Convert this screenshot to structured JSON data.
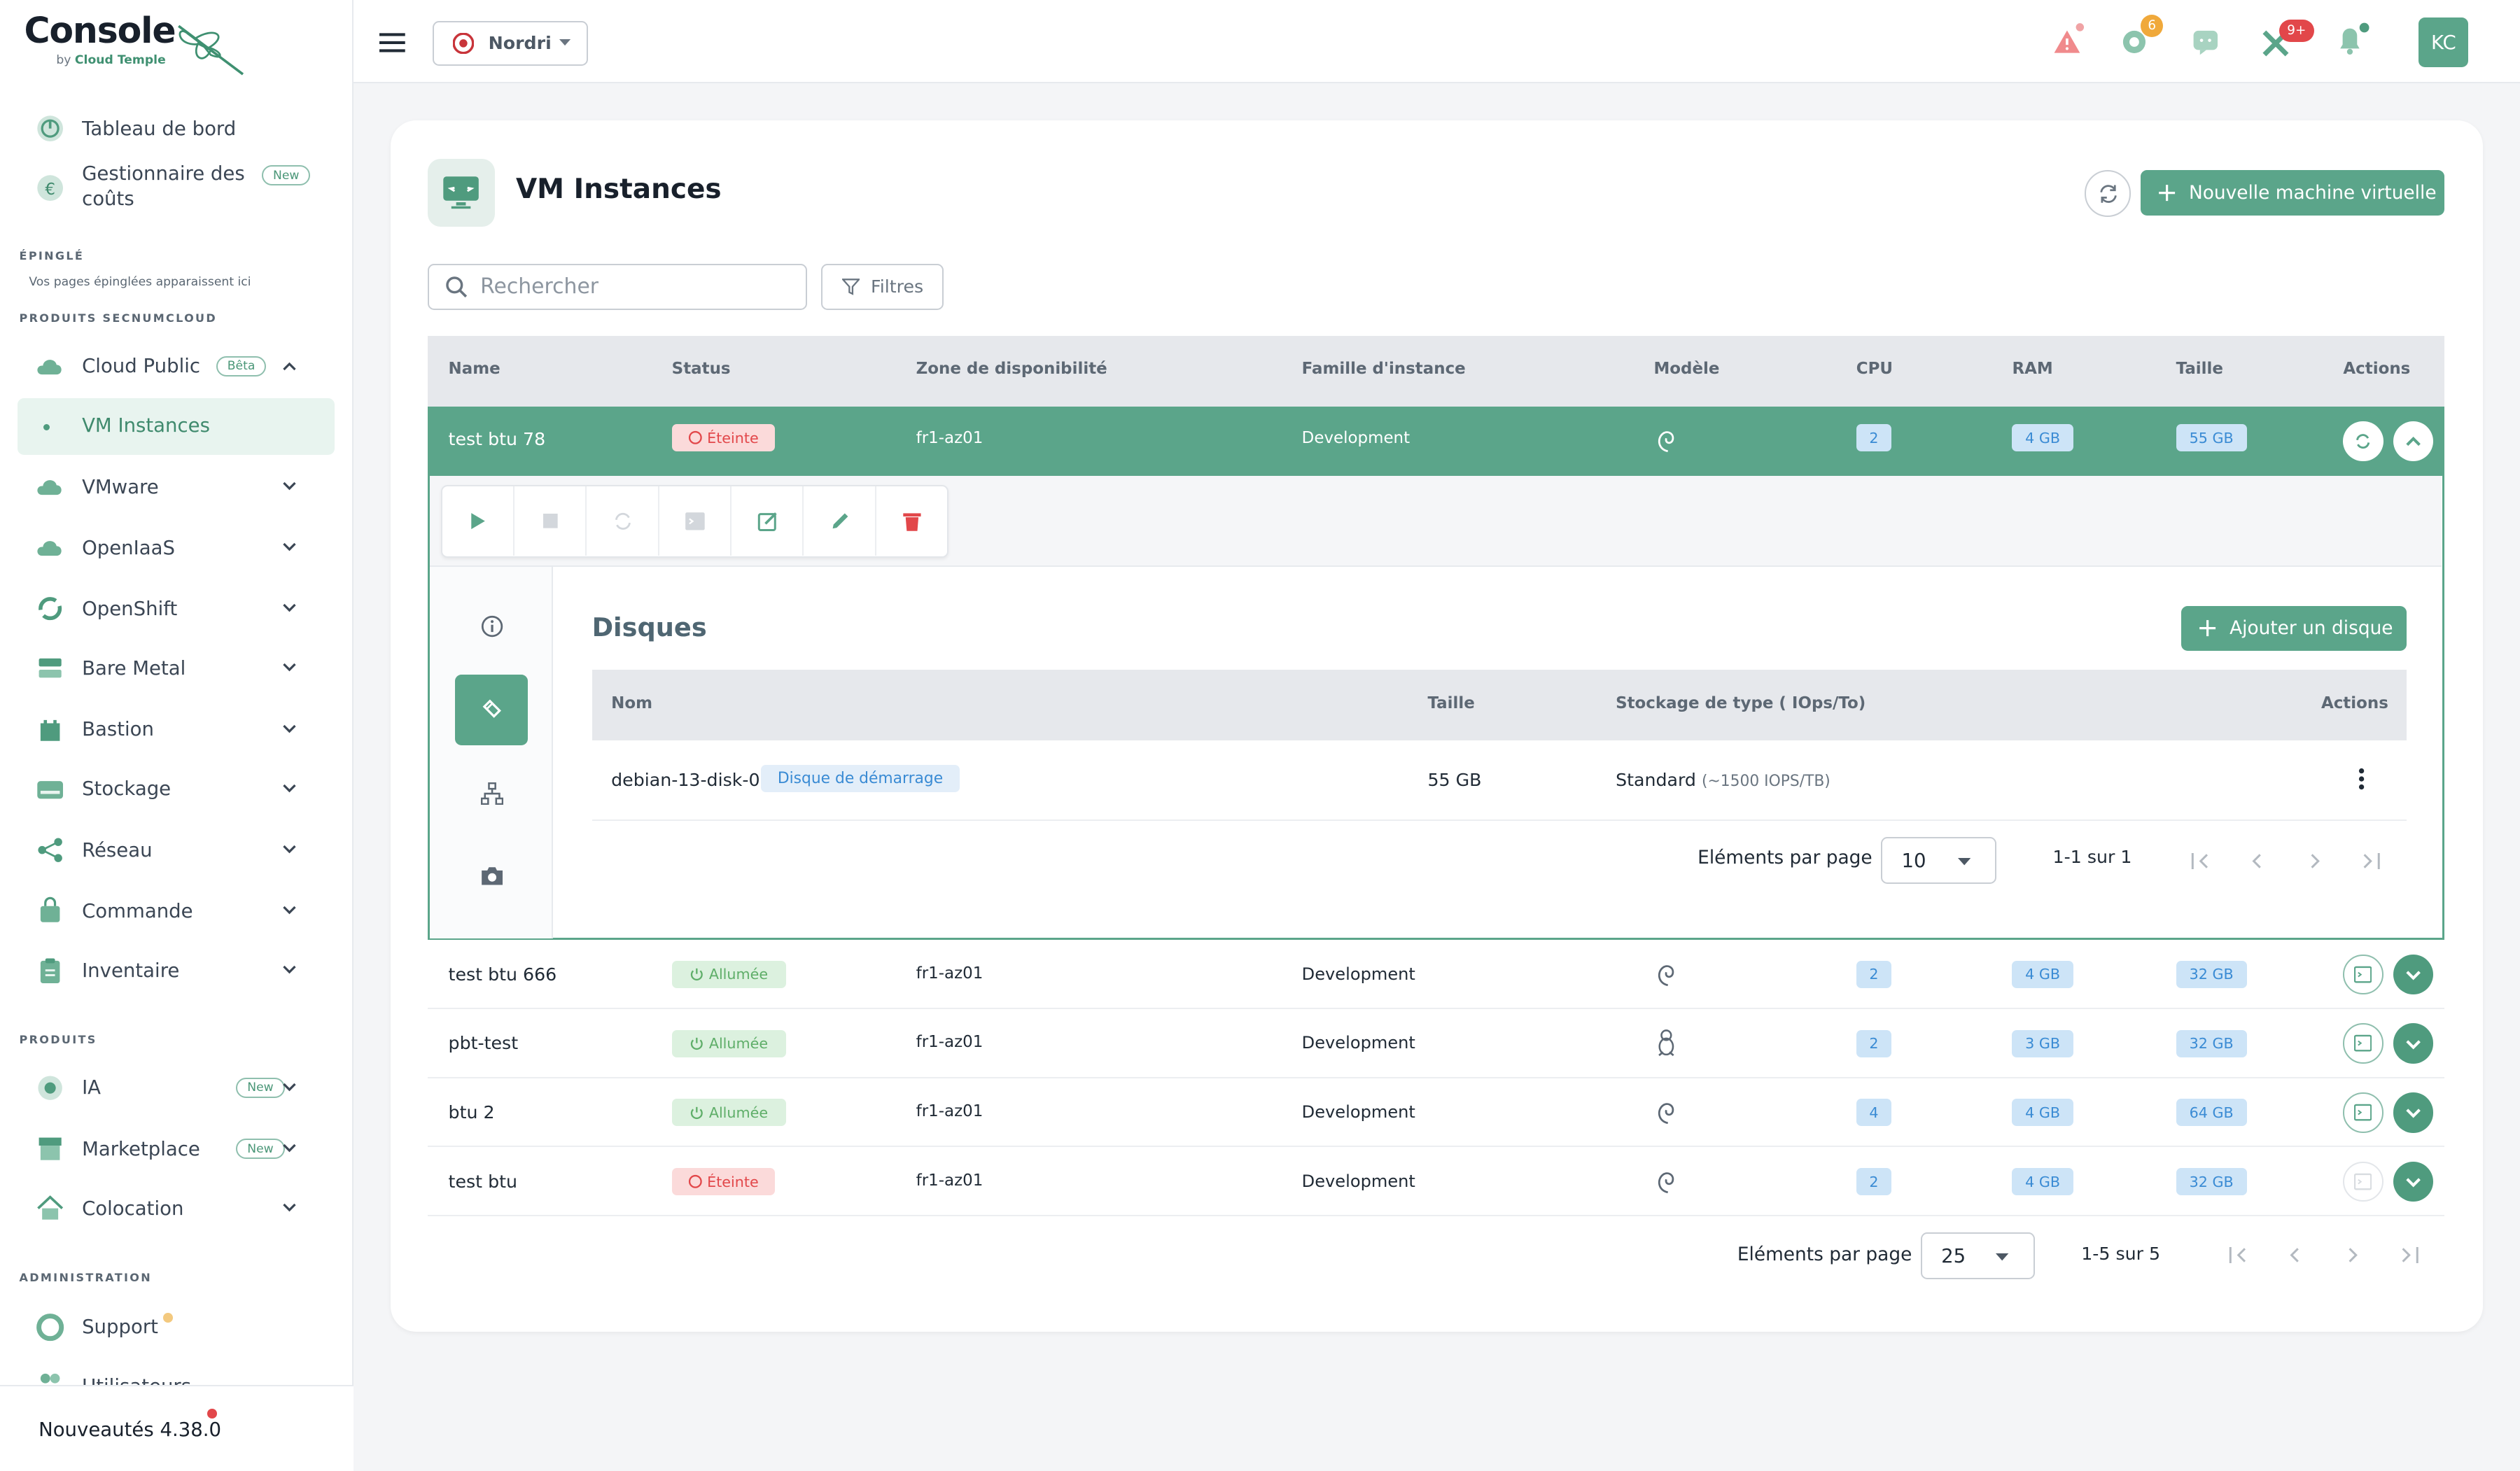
{
  "app": {
    "brand": "Console",
    "brand_sub_prefix": "by",
    "brand_sub_name": "Cloud Temple"
  },
  "sidebar": {
    "top_items": [
      {
        "label": "Tableau de bord"
      },
      {
        "label": "Gestionnaire des coûts",
        "badge": "New"
      }
    ],
    "pinned_title": "ÉPINGLÉ",
    "pinned_hint": "Vos pages épinglées apparaissent ici",
    "products_secnumcloud_title": "PRODUITS SECNUMCLOUD",
    "cloud_public": {
      "label": "Cloud Public",
      "badge": "Bêta"
    },
    "active_item": "VM Instances",
    "secnum_items": [
      "VMware",
      "OpenIaaS",
      "OpenShift",
      "Bare Metal",
      "Bastion",
      "Stockage",
      "Réseau",
      "Commande",
      "Inventaire"
    ],
    "products_title": "PRODUITS",
    "product_items": [
      {
        "label": "IA",
        "badge": "New"
      },
      {
        "label": "Marketplace",
        "badge": "New"
      },
      {
        "label": "Colocation"
      }
    ],
    "admin_title": "ADMINISTRATION",
    "admin_items": [
      "Support",
      "Utilisateurs"
    ],
    "footer": "Nouveautés 4.38.0"
  },
  "header": {
    "tenant": "Nordri",
    "notifications": {
      "tasks": "6",
      "alerts": "9+"
    },
    "avatar": "KC"
  },
  "page": {
    "title": "VM Instances",
    "new_vm_button": "Nouvelle machine virtuelle",
    "search_placeholder": "Rechercher",
    "filters_button": "Filtres"
  },
  "table": {
    "columns": [
      "Name",
      "Status",
      "Zone de disponibilité",
      "Famille d'instance",
      "Modèle",
      "CPU",
      "RAM",
      "Taille",
      "Actions"
    ],
    "rows": [
      {
        "name": "test btu 78",
        "status": "Éteinte",
        "zone": "fr1-az01",
        "family": "Development",
        "os": "debian",
        "cpu": "2",
        "ram": "4 GB",
        "size": "55 GB",
        "expanded": true
      },
      {
        "name": "test btu 666",
        "status": "Allumée",
        "zone": "fr1-az01",
        "family": "Development",
        "os": "debian",
        "cpu": "2",
        "ram": "4 GB",
        "size": "32 GB"
      },
      {
        "name": "pbt-test",
        "status": "Allumée",
        "zone": "fr1-az01",
        "family": "Development",
        "os": "linux",
        "cpu": "2",
        "ram": "3 GB",
        "size": "32 GB"
      },
      {
        "name": "btu 2",
        "status": "Allumée",
        "zone": "fr1-az01",
        "family": "Development",
        "os": "debian",
        "cpu": "4",
        "ram": "4 GB",
        "size": "64 GB"
      },
      {
        "name": "test btu",
        "status": "Éteinte",
        "zone": "fr1-az01",
        "family": "Development",
        "os": "debian",
        "cpu": "2",
        "ram": "4 GB",
        "size": "32 GB"
      }
    ],
    "pagination": {
      "label": "Eléments par page",
      "per_page": "25",
      "range": "1-5 sur 5"
    }
  },
  "details": {
    "section_title": "Disques",
    "add_disk_button": "Ajouter un disque",
    "columns": [
      "Nom",
      "Taille",
      "Stockage de type ( IOps/To)",
      "Actions"
    ],
    "disks": [
      {
        "name": "debian-13-disk-0",
        "tag": "Disque de démarrage",
        "size": "55 GB",
        "storage": "Standard",
        "storage_detail": "(~1500 IOPS/TB)"
      }
    ],
    "pagination": {
      "label": "Eléments par page",
      "per_page": "10",
      "range": "1-1 sur 1"
    }
  },
  "colors": {
    "accent": "#5ba58a",
    "danger": "#e2474a",
    "chip_blue": "#cde4f7"
  }
}
